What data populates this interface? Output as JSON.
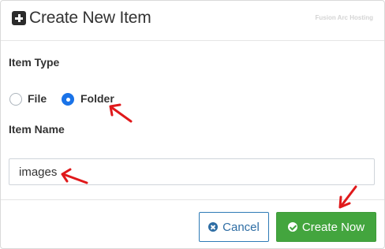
{
  "dialog": {
    "title": "Create New Item",
    "title_icon": "plus-square-icon",
    "watermark": "Fusion Arc Hosting"
  },
  "form": {
    "item_type_label": "Item Type",
    "options": [
      {
        "label": "File",
        "selected": false
      },
      {
        "label": "Folder",
        "selected": true
      }
    ],
    "item_name_label": "Item Name",
    "item_name_value": "images"
  },
  "buttons": {
    "cancel_label": "Cancel",
    "cancel_icon": "times-circle-icon",
    "create_label": "Create Now",
    "create_icon": "check-circle-icon"
  },
  "colors": {
    "accent_blue": "#1a73e8",
    "cancel_blue": "#2e6da4",
    "create_green": "#43a53e",
    "annotation_red": "#e0191b"
  }
}
